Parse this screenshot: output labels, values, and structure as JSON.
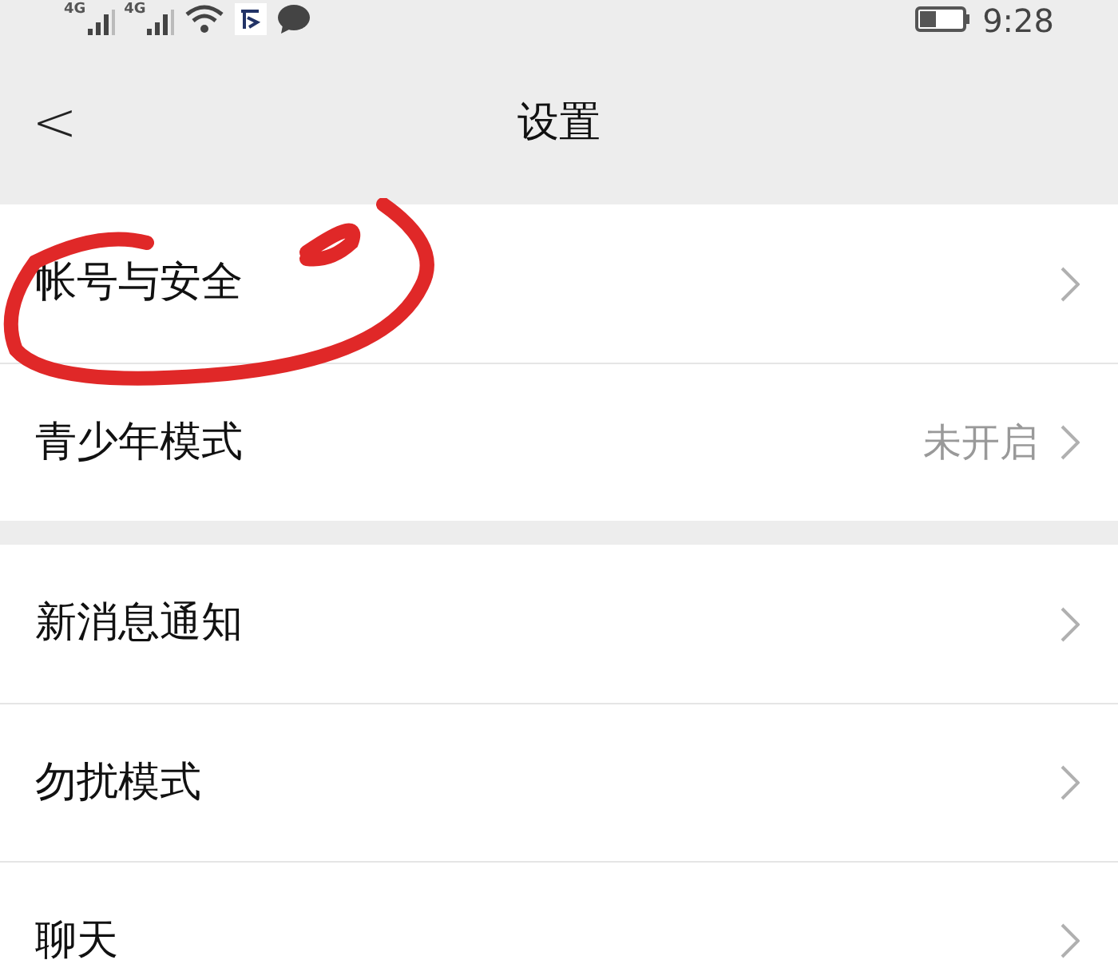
{
  "status_bar": {
    "signals": [
      {
        "network": "4G"
      },
      {
        "network": "4G"
      }
    ],
    "battery": {
      "level": 0.4
    },
    "time": "9:28"
  },
  "header": {
    "back": "<",
    "title": "设置"
  },
  "groups": [
    {
      "items": [
        {
          "label": "帐号与安全",
          "annotated": true
        },
        {
          "label": "青少年模式",
          "value": "未开启",
          "annotated": false
        }
      ]
    },
    {
      "items": [
        {
          "label": "新消息通知",
          "annotated": false
        },
        {
          "label": "勿扰模式",
          "annotated": false
        },
        {
          "label": "聊天",
          "annotated": false
        }
      ]
    }
  ]
}
